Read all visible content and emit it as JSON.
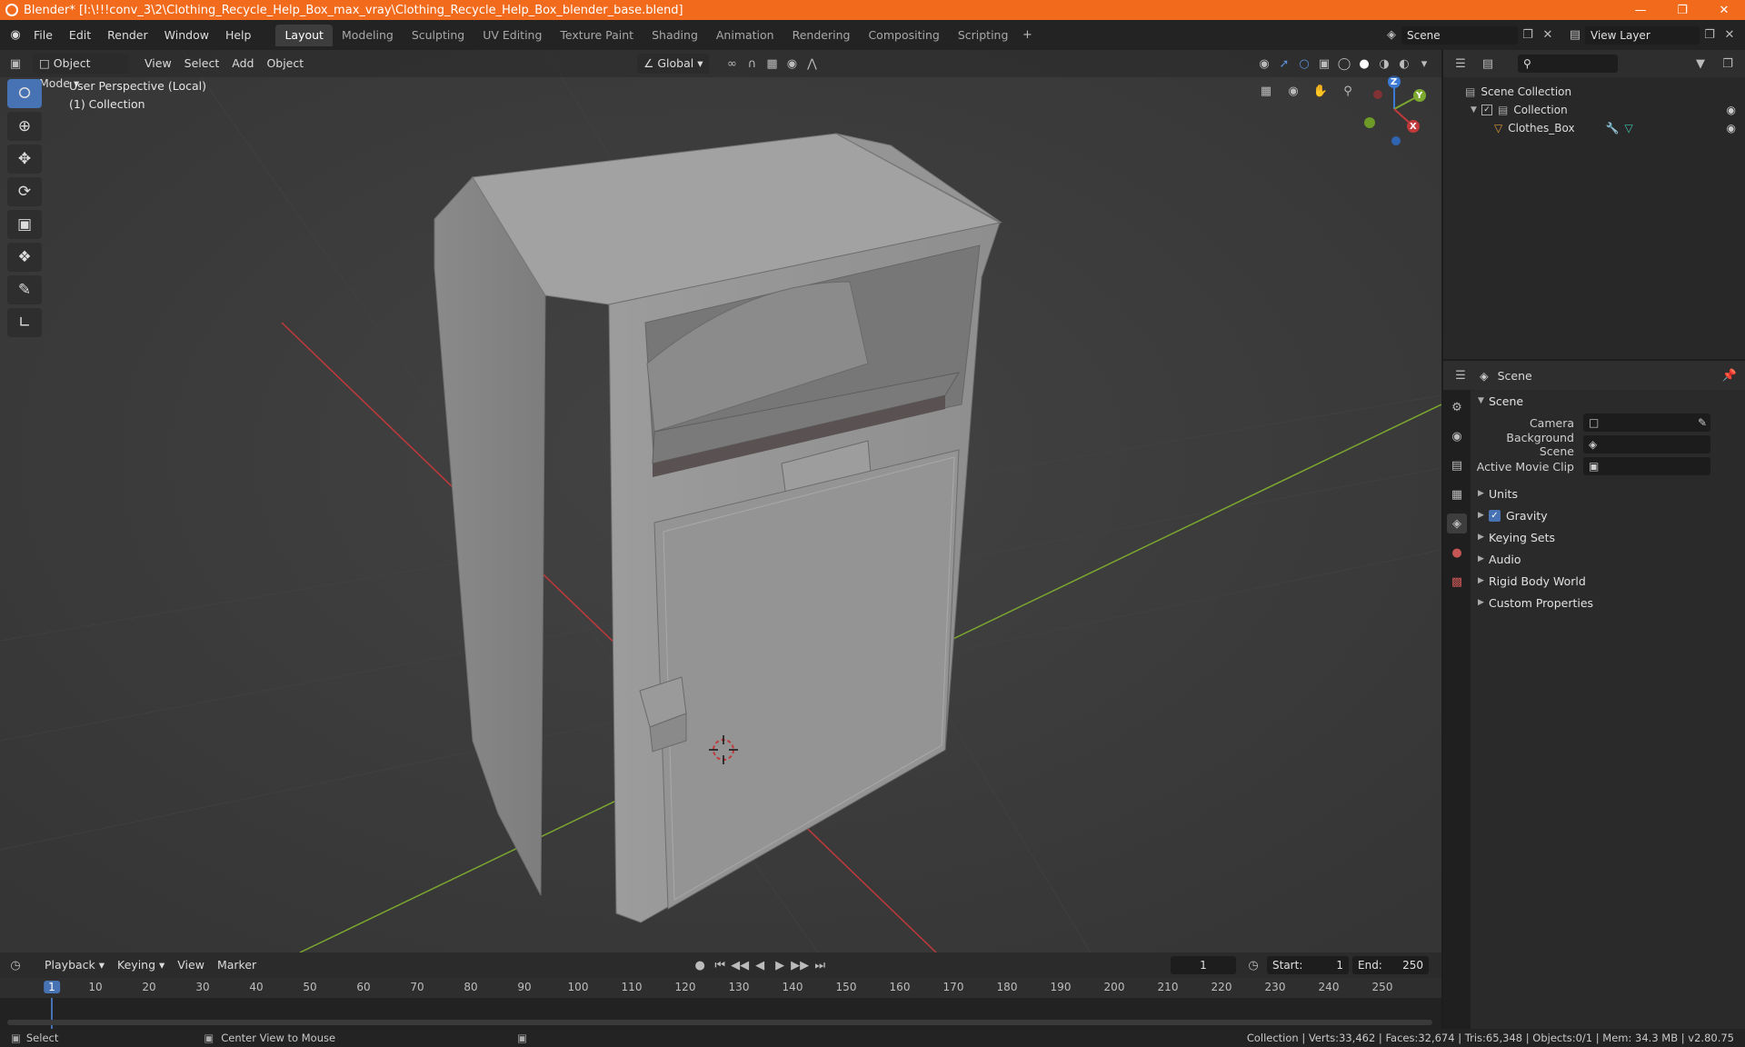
{
  "window": {
    "title": "Blender* [I:\\!!!conv_3\\2\\Clothing_Recycle_Help_Box_max_vray\\Clothing_Recycle_Help_Box_blender_base.blend]"
  },
  "menu": [
    "File",
    "Edit",
    "Render",
    "Window",
    "Help"
  ],
  "workspaces": [
    {
      "label": "Layout",
      "active": true
    },
    {
      "label": "Modeling"
    },
    {
      "label": "Sculpting"
    },
    {
      "label": "UV Editing"
    },
    {
      "label": "Texture Paint"
    },
    {
      "label": "Shading"
    },
    {
      "label": "Animation"
    },
    {
      "label": "Rendering"
    },
    {
      "label": "Compositing"
    },
    {
      "label": "Scripting"
    }
  ],
  "scene_field": "Scene",
  "view_layer_field": "View Layer",
  "viewport": {
    "mode": "Object Mode",
    "menus": [
      "View",
      "Select",
      "Add",
      "Object"
    ],
    "orientation": "Global",
    "perspective_label": "User Perspective (Local)",
    "collection_label": "(1) Collection",
    "gizmo_axes": [
      "Z",
      "Y",
      "X"
    ]
  },
  "outliner": {
    "root": "Scene Collection",
    "collection": "Collection",
    "object": "Clothes_Box"
  },
  "properties": {
    "header": "Scene",
    "panel_scene": "Scene",
    "camera_label": "Camera",
    "background_scene_label": "Background Scene",
    "active_movie_clip_label": "Active Movie Clip",
    "collapsed_panels": [
      "Units",
      "Gravity",
      "Keying Sets",
      "Audio",
      "Rigid Body World",
      "Custom Properties"
    ],
    "gravity_checked": true
  },
  "timeline": {
    "menus": [
      "Playback",
      "Keying",
      "View",
      "Marker"
    ],
    "current_frame": "1",
    "start_label": "Start:",
    "start_value": "1",
    "end_label": "End:",
    "end_value": "250",
    "ruler_marks": [
      "1",
      "10",
      "20",
      "30",
      "40",
      "50",
      "60",
      "70",
      "80",
      "90",
      "100",
      "110",
      "120",
      "130",
      "140",
      "150",
      "160",
      "170",
      "180",
      "190",
      "200",
      "210",
      "220",
      "230",
      "240",
      "250"
    ]
  },
  "statusbar": {
    "left_action": "Select",
    "middle_action": "Center View to Mouse",
    "stats": "Collection | Verts:33,462 | Faces:32,674 | Tris:65,348 | Objects:0/1 | Mem: 34.3 MB | v2.80.75"
  },
  "colors": {
    "title_bar": "#f26a1b",
    "active_tool": "#4772b3",
    "axis_x": "#c0393b",
    "axis_y": "#7ca82f",
    "axis_z": "#3b7bd6"
  }
}
